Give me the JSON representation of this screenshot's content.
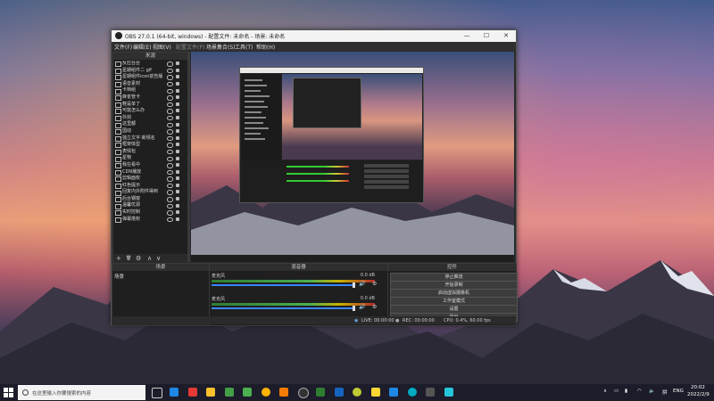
{
  "window": {
    "title": "OBS 27.0.1 (64-bit, windows) - 配置文件: 未命名 - 场景: 未命名",
    "controls": [
      "—",
      "☐",
      "✕"
    ]
  },
  "menu": [
    "文件(F)",
    "编辑(E)",
    "视图(V)",
    "配置文件(P)",
    "场景集合(S)",
    "工具(T)",
    "帮助(H)"
  ],
  "scenes": {
    "header": "来源",
    "items": [
      "反应台台",
      "星期组件二 gif",
      "星期组件icon前告版",
      "语音素材",
      "卡档组",
      "麻雀管卡",
      "鞋是单了",
      "可能怎么办",
      "抖剑",
      "这里都",
      "国动",
      "独立文字·新规名",
      "框架体型",
      "表情包",
      "星物",
      "我在看中",
      "CDN播放",
      "剪辑面权",
      "红色提示",
      "回复内外附件得到",
      "后台钢窗",
      "温馨优源",
      "实时控制",
      "弹幕搭权"
    ],
    "footer": [
      "+",
      "🗑",
      "⚙",
      "∧",
      "∨"
    ]
  },
  "panels": {
    "scenes_title": "场景",
    "scene_name": "场景",
    "mixer_title": "混音器",
    "controls_title": "控件"
  },
  "mixer": {
    "tracks": [
      {
        "name": "麦克风",
        "db": "0.0 dB",
        "level": 0.75
      },
      {
        "name": "麦克风",
        "db": "0.0 dB",
        "level": 0.75
      }
    ]
  },
  "controls": [
    "停止推流",
    "开始录制",
    "启动虚拟摄像机",
    "工作室模式",
    "设置",
    "退出"
  ],
  "statusbar": {
    "live": "LIVE: 00:00:00",
    "rec": "REC: 00:00:00",
    "cpu": "CPU: 0.4%, 60.00 fps"
  },
  "taskbar": {
    "search_placeholder": "在这里输入你要搜索的内容",
    "lang": "ENG",
    "time": "20:02",
    "date": "2022/2/9"
  },
  "colors": {
    "accent": "#3a86ff",
    "meter_green": "#4caf50",
    "meter_yellow": "#c8b400",
    "meter_red": "#b52b2b"
  }
}
